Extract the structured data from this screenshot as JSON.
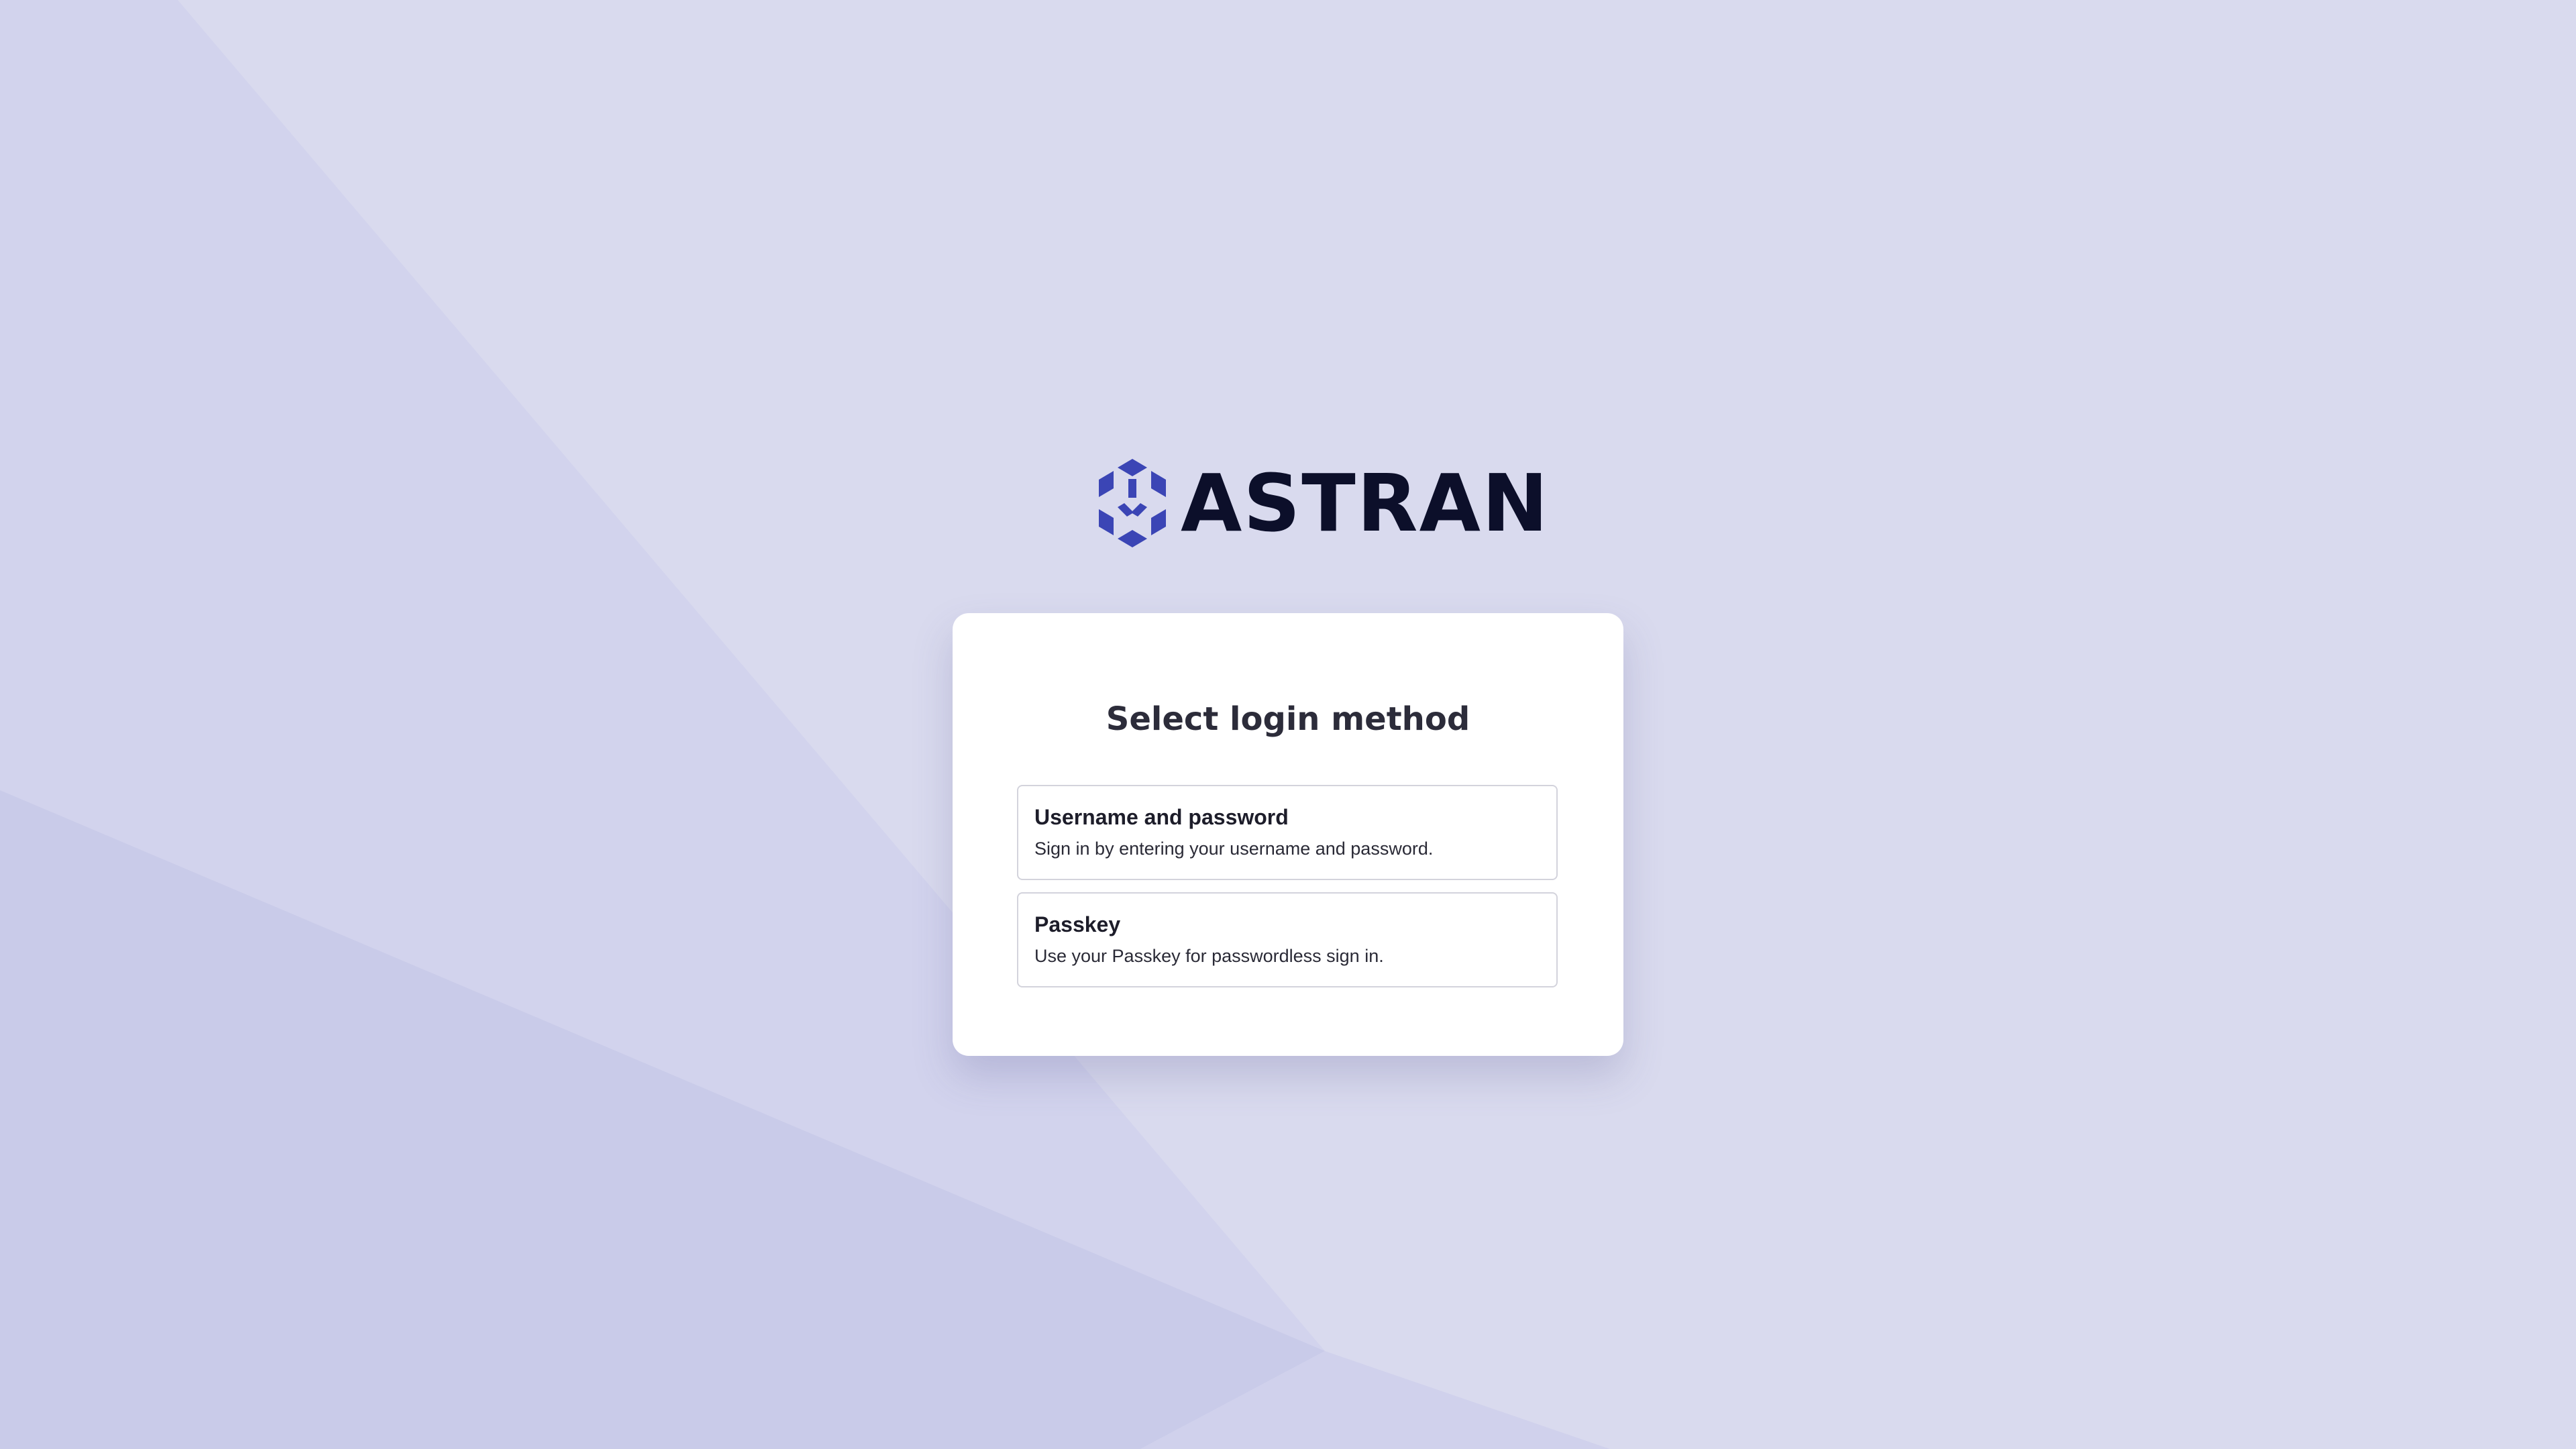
{
  "brand": {
    "name": "ASTRAN",
    "logo_icon": "hexagon-cube-logo",
    "accent_color": "#3b45b5",
    "text_color": "#0c0f2a"
  },
  "card": {
    "title": "Select login method",
    "options": [
      {
        "title": "Username and password",
        "description": "Sign in by entering your username and password."
      },
      {
        "title": "Passkey",
        "description": "Use your Passkey for passwordless sign in."
      }
    ]
  },
  "colors": {
    "background": "#d9daee",
    "card": "#ffffff"
  }
}
